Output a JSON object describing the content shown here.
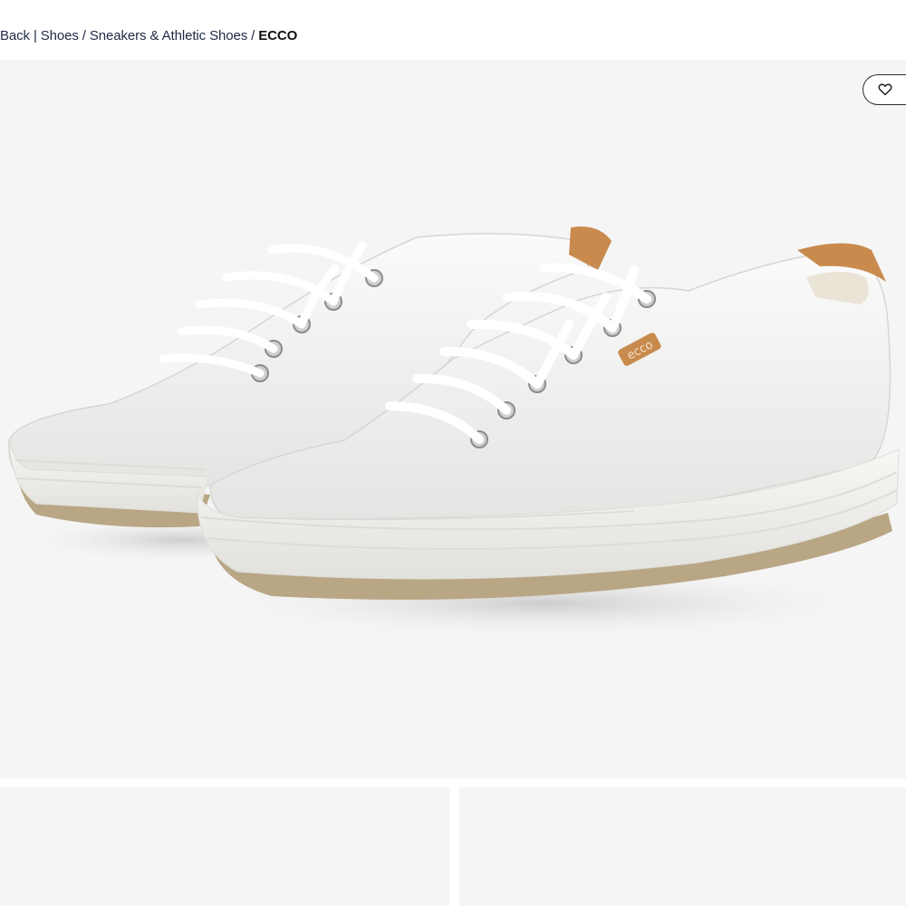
{
  "breadcrumb": {
    "back_label": "Back",
    "divider": "|",
    "items": [
      "Shoes",
      "Sneakers & Athletic Shoes"
    ],
    "separator": "/",
    "current": "ECCO"
  },
  "product_image": {
    "favorite_icon": "heart-outline-icon",
    "background_color": "#f5f5f5",
    "logo_tag_text": "ecco"
  },
  "thumbnails": {
    "count": 2
  }
}
